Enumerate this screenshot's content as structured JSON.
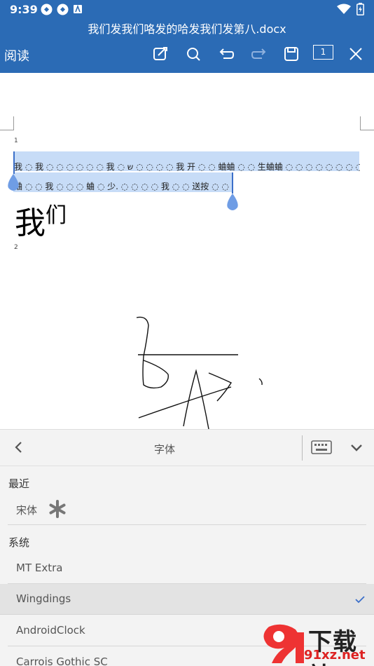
{
  "status": {
    "time": "9:39"
  },
  "app": {
    "doc_title": "我们发我们咯发的哈发我们发第八.docx",
    "mode_label": "阅读",
    "page_indicator": "1"
  },
  "colors": {
    "accent": "#2b6bb5",
    "selection": "#c7dcf7",
    "check": "#3b6fc9"
  },
  "document": {
    "page_numbers": [
      "1",
      "2"
    ],
    "lines": [
      "我 ◌ 我 ◌ ◌ ◌ ◌ ◌ ◌ 我 ◌ ש ◌ ◌ ◌ ◌ 我 开 ◌ ◌ 蛐蛐 ◌ ◌ 生蛐蛐 ◌ ◌ ◌ ◌ ◌ ◌ ◌ ◌ ◌ ◌",
      "蛐 ◌ ◌ 我 ◌ ◌ ◌ 蛐 ◌ 少. ◌ ◌ ◌ ◌ 我 ◌ ◌ 送按 ◌ ◌"
    ],
    "big_text": "我",
    "big_text_small": "们"
  },
  "font_panel": {
    "title": "字体",
    "recent_header": "最近",
    "recent_items": [
      {
        "label": "宋体"
      }
    ],
    "system_header": "系统",
    "system_items": [
      {
        "label": "MT Extra",
        "selected": false
      },
      {
        "label": "Wingdings",
        "selected": true
      },
      {
        "label": "AndroidClock",
        "selected": false
      },
      {
        "label": "Carrois Gothic SC",
        "selected": false
      }
    ]
  },
  "watermark": {
    "text": "下载站",
    "url": "91xz.net"
  }
}
